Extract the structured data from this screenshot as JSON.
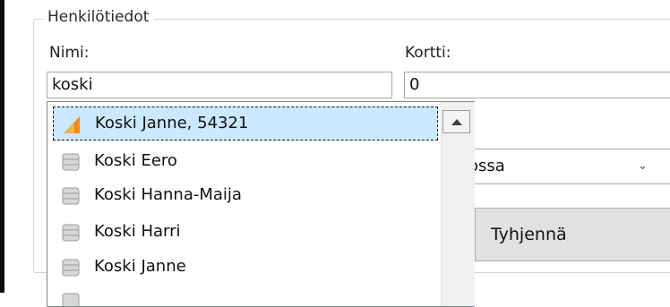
{
  "group": {
    "title": "Henkilötiedot"
  },
  "fields": {
    "name_label": "Nimi:",
    "name_value": "koski",
    "card_label": "Kortti:",
    "card_value": "0"
  },
  "combo": {
    "visible_text": "ossa"
  },
  "buttons": {
    "clear_label": "Tyhjennä"
  },
  "suggestions": {
    "items": [
      {
        "label": "Koski Janne, 54321",
        "icon": "brand-icon"
      },
      {
        "label": "Koski Eero",
        "icon": "database-icon"
      },
      {
        "label": "Koski Hanna-Maija",
        "icon": "database-icon"
      },
      {
        "label": "Koski Harri",
        "icon": "database-icon"
      },
      {
        "label": "Koski Janne",
        "icon": "database-icon"
      }
    ]
  },
  "colors": {
    "selection": "#cce8ff",
    "brand_orange": "#f08a1c",
    "button_face": "#e1e1e1"
  }
}
